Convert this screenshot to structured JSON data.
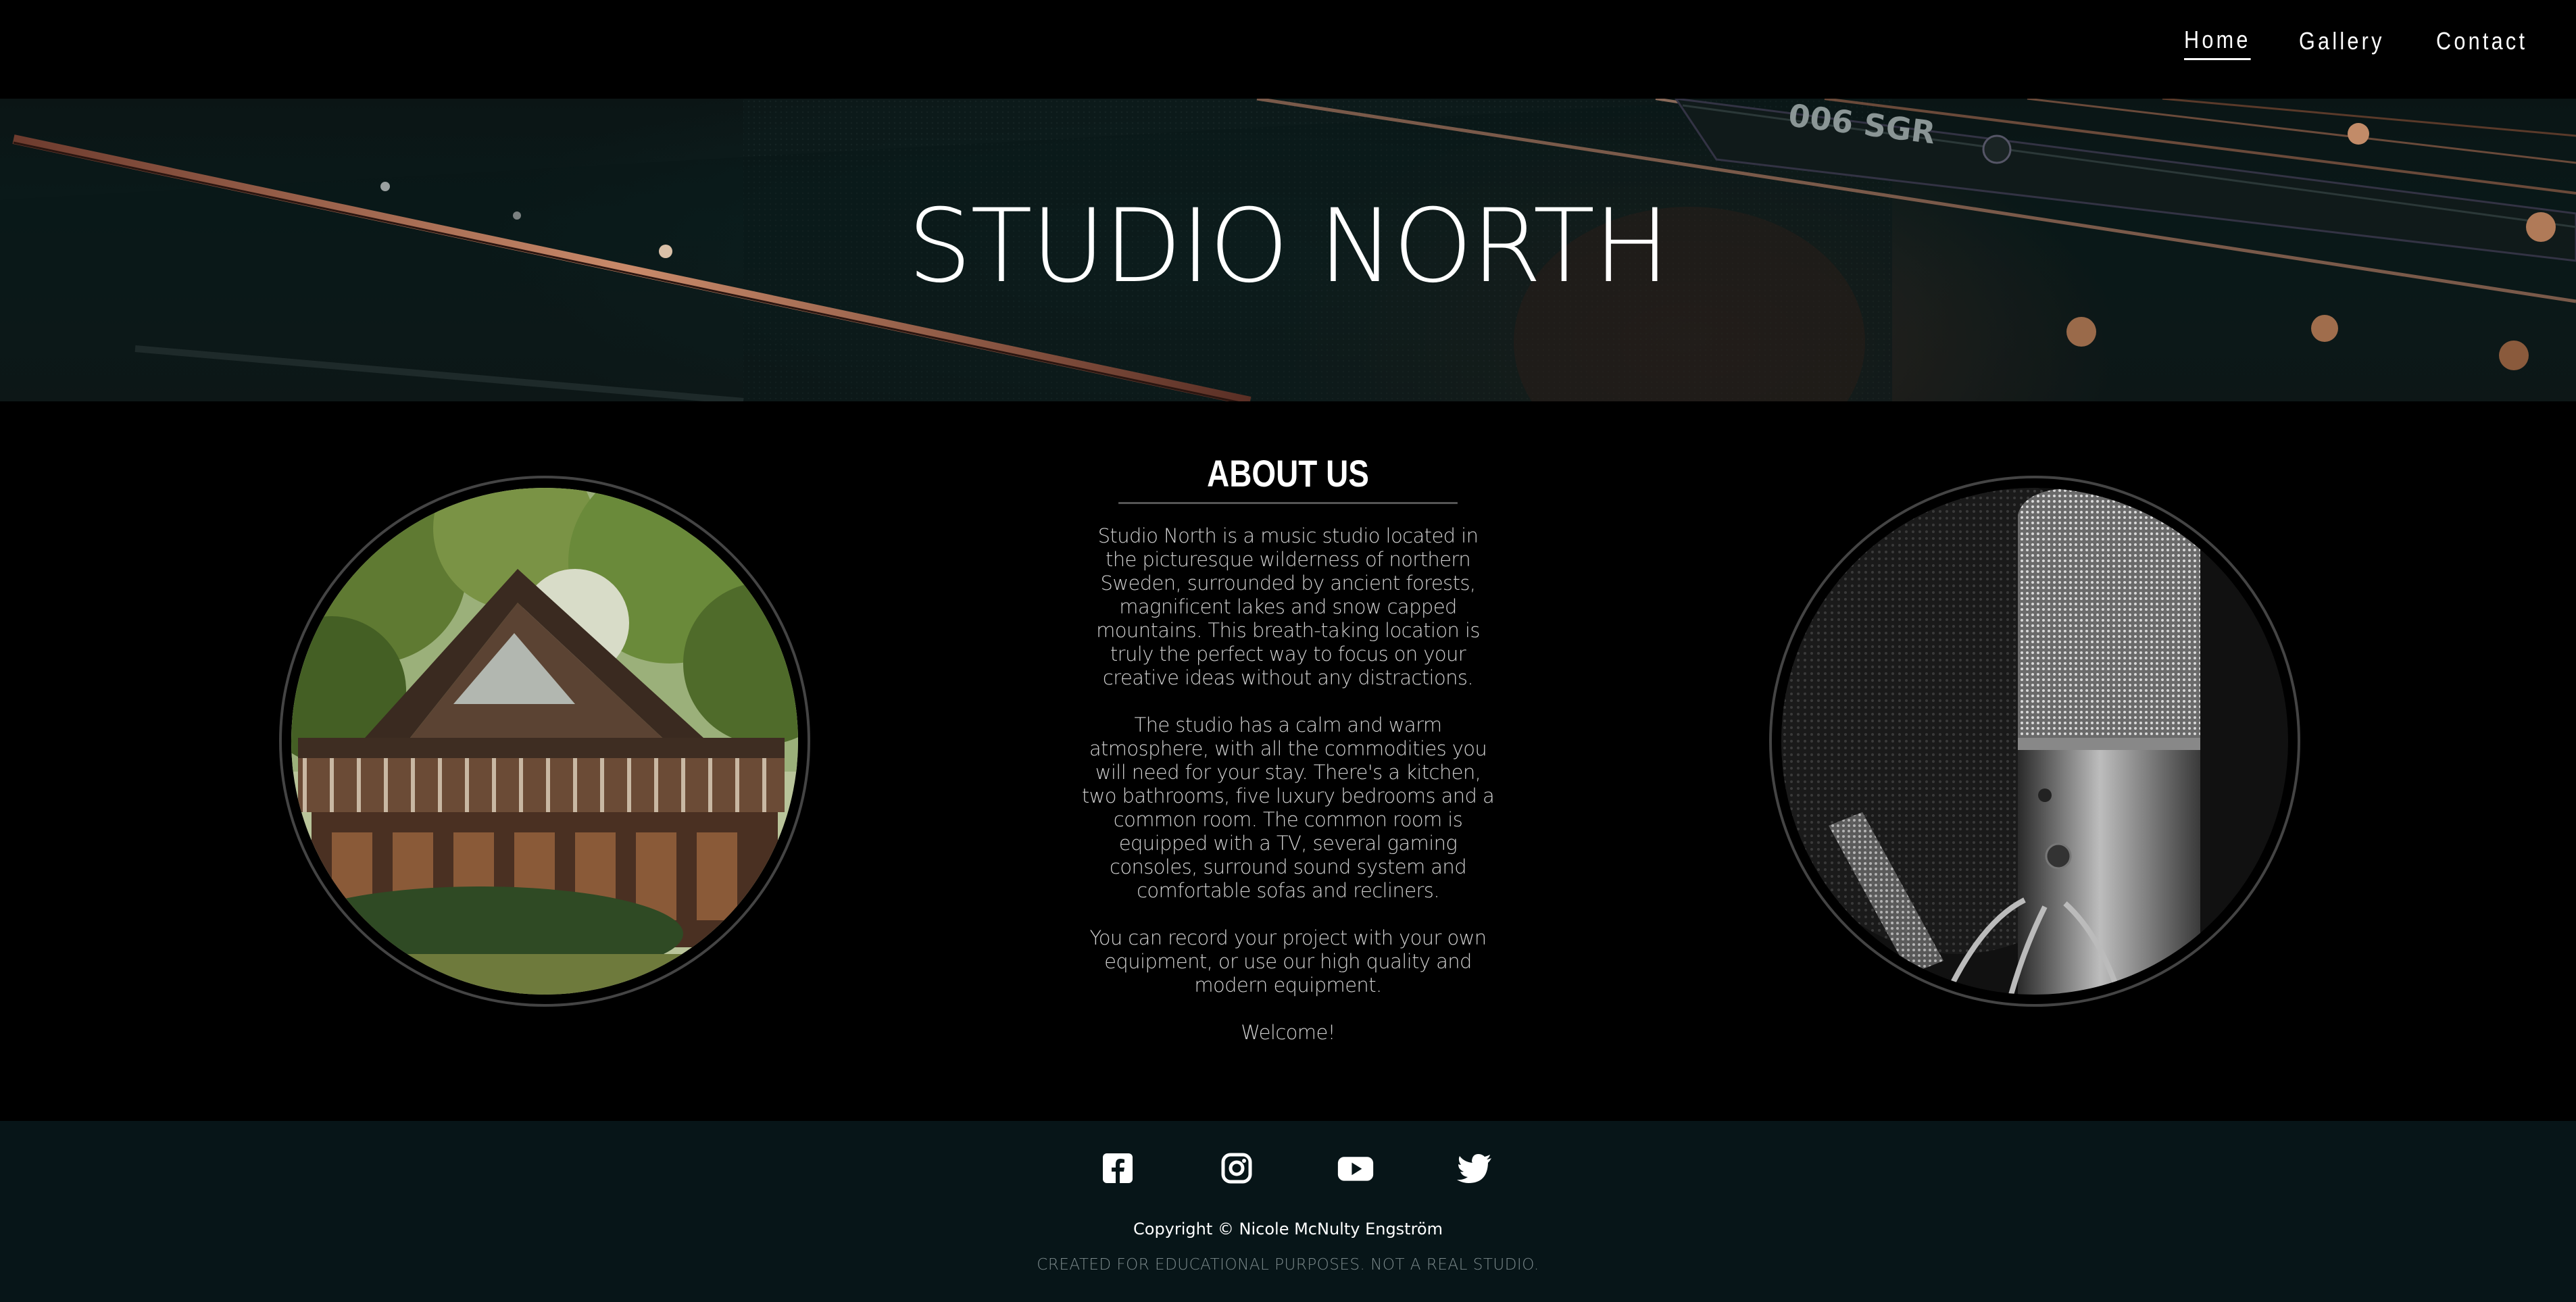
{
  "nav": {
    "items": [
      {
        "label": "Home",
        "active": true
      },
      {
        "label": "Gallery",
        "active": false
      },
      {
        "label": "Contact",
        "active": false
      }
    ]
  },
  "hero": {
    "title": "STUDIO NORTH",
    "image_text": "006 SGR"
  },
  "about": {
    "title": "ABOUT US",
    "paragraphs": [
      "Studio North is a music studio located in the picturesque wilderness of northern Sweden, surrounded by ancient forests, magnificent lakes and snow capped mountains. This breath-taking location is truly the perfect way to focus on your creative ideas without any distractions.",
      "The studio has a calm and warm atmosphere, with all the commodities you will need for your stay. There's a kitchen, two bathrooms, five luxury bedrooms and a common room. The common room is equipped with a TV, several gaming consoles, surround sound system and comfortable sofas and recliners.",
      "You can record your project with your own equipment, or use our high quality and modern equipment.",
      "Welcome!"
    ]
  },
  "images": {
    "left": "cabin-photo",
    "right": "microphone-photo"
  },
  "footer": {
    "social": [
      "facebook-icon",
      "instagram-icon",
      "youtube-icon",
      "twitter-icon"
    ],
    "copyright": "Copyright © Nicole McNulty Engström",
    "disclaimer": "CREATED FOR EDUCATIONAL PURPOSES. NOT A REAL STUDIO."
  },
  "colors": {
    "background": "#000000",
    "footer_bg": "#071518",
    "text": "#cfcfcf"
  }
}
